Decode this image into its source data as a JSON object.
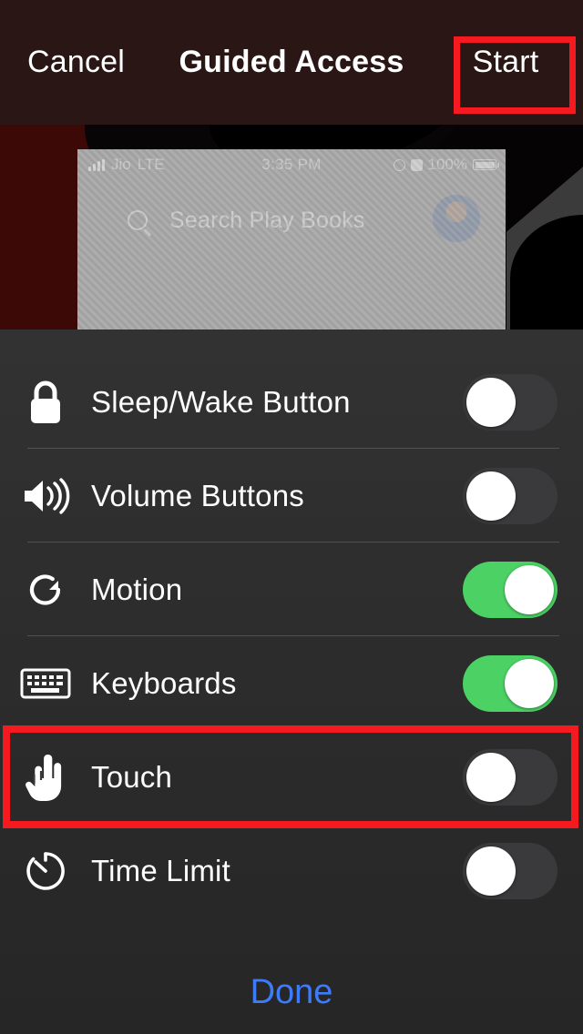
{
  "topbar": {
    "cancel_label": "Cancel",
    "title": "Guided Access",
    "start_label": "Start"
  },
  "preview": {
    "status_carrier": "Jio",
    "status_network": "LTE",
    "status_time": "3:35 PM",
    "status_battery_percent": "100%",
    "search_placeholder": "Search Play Books",
    "signal_icon": "signal-bars-icon",
    "orientation_lock_icon": "orientation-lock-icon",
    "alarm_icon": "alarm-icon",
    "battery_icon": "battery-full-icon",
    "search_icon": "search-icon",
    "avatar_icon": "account-avatar"
  },
  "options": [
    {
      "label": "Sleep/Wake Button",
      "icon": "lock-icon",
      "enabled": false,
      "state_label": "Off"
    },
    {
      "label": "Volume Buttons",
      "icon": "volume-icon",
      "enabled": false,
      "state_label": "Off"
    },
    {
      "label": "Motion",
      "icon": "rotate-icon",
      "enabled": true,
      "state_label": "On"
    },
    {
      "label": "Keyboards",
      "icon": "keyboard-icon",
      "enabled": true,
      "state_label": "On"
    },
    {
      "label": "Touch",
      "icon": "pointing-hand-icon",
      "enabled": false,
      "state_label": "Off"
    },
    {
      "label": "Time Limit",
      "icon": "timer-icon",
      "enabled": false,
      "state_label": "Off"
    }
  ],
  "footer": {
    "done_label": "Done"
  },
  "highlights": [
    {
      "target": "start-button",
      "color": "#f41a20"
    },
    {
      "target": "touch-row",
      "color": "#f41a20"
    }
  ],
  "colors": {
    "toggle_on": "#4cd264",
    "toggle_off": "#3a3a3d",
    "accent_blue": "#3d7bfa",
    "highlight_red": "#f41a20",
    "topbar_bg": "#2a1715",
    "sheet_bg": "#2d2d2d"
  }
}
